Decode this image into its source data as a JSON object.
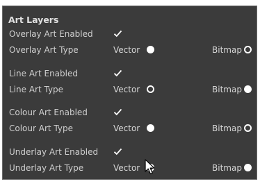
{
  "panel": {
    "heading": "Art Layers",
    "groups": [
      {
        "enabled_label": "Overlay Art Enabled",
        "type_label": "Overlay Art Type",
        "enabled": true,
        "options": [
          {
            "label": "Vector",
            "selected": false
          },
          {
            "label": "Bitmap",
            "selected": true
          }
        ]
      },
      {
        "enabled_label": "Line Art Enabled",
        "type_label": "Line Art Type",
        "enabled": true,
        "options": [
          {
            "label": "Vector",
            "selected": true
          },
          {
            "label": "Bitmap",
            "selected": false
          }
        ]
      },
      {
        "enabled_label": "Colour Art Enabled",
        "type_label": "Colour Art Type",
        "enabled": true,
        "options": [
          {
            "label": "Vector",
            "selected": false
          },
          {
            "label": "Bitmap",
            "selected": true
          }
        ]
      },
      {
        "enabled_label": "Underlay Art Enabled",
        "type_label": "Underlay Art Type",
        "enabled": true,
        "options": [
          {
            "label": "Vector",
            "selected": true
          },
          {
            "label": "Bitmap",
            "selected": false
          }
        ]
      }
    ]
  },
  "icons": {
    "checkmark": "check-icon",
    "cursor": "mouse-pointer-icon"
  },
  "colors": {
    "panel_bg": "#3b3b3b",
    "text": "#cfcfcf",
    "heading": "#e0e0e0",
    "control": "#ffffff"
  }
}
